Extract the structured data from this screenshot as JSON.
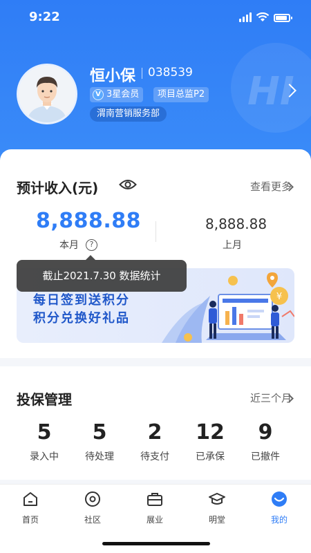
{
  "status": {
    "time": "9:22"
  },
  "profile": {
    "name": "恒小保",
    "id": "038539",
    "member_level": "3星会员",
    "member_icon_letter": "V",
    "title": "项目总监P2",
    "department": "渭南营销服务部",
    "watermark": "HI"
  },
  "income": {
    "title": "预计收入(元)",
    "more": "查看更多",
    "this_month_amount": "8,888.88",
    "this_month_label": "本月",
    "last_month_amount": "8,888.88",
    "last_month_label": "上月",
    "tooltip": "截止2021.7.30 数据统计"
  },
  "banner": {
    "line1": "每日签到送积分",
    "line2": "积分兑换好礼品"
  },
  "policy": {
    "title": "投保管理",
    "range": "近三个月",
    "stats": [
      {
        "value": "5",
        "label": "录入中"
      },
      {
        "value": "5",
        "label": "待处理"
      },
      {
        "value": "2",
        "label": "待支付"
      },
      {
        "value": "12",
        "label": "已承保"
      },
      {
        "value": "9",
        "label": "已撤件"
      }
    ]
  },
  "tabbar": [
    {
      "label": "首页",
      "icon": "home-icon"
    },
    {
      "label": "社区",
      "icon": "community-icon"
    },
    {
      "label": "展业",
      "icon": "briefcase-icon"
    },
    {
      "label": "明堂",
      "icon": "graduation-cap-icon"
    },
    {
      "label": "我的",
      "icon": "profile-face-icon",
      "active": true
    }
  ],
  "colors": {
    "primary": "#2f7df6",
    "banner_text": "#1f57c9"
  }
}
